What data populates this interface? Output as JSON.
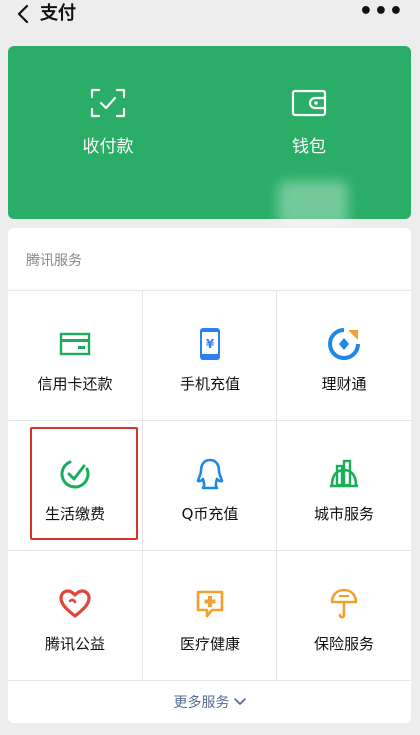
{
  "header": {
    "title": "支付",
    "more_label": "•••"
  },
  "pay_card": {
    "items": [
      {
        "label": "收付款",
        "icon": "scan-frame-icon"
      },
      {
        "label": "钱包",
        "icon": "wallet-icon"
      }
    ]
  },
  "services": {
    "heading": "腾讯服务",
    "items": [
      {
        "label": "信用卡还款",
        "icon": "credit-card-icon",
        "color": "#1aad5c"
      },
      {
        "label": "手机充值",
        "icon": "phone-yen-icon",
        "color": "#2e7ff0"
      },
      {
        "label": "理财通",
        "icon": "wealth-icon",
        "color": "#1e88e5"
      },
      {
        "label": "生活缴费",
        "icon": "check-circle-icon",
        "color": "#1aad5c"
      },
      {
        "label": "Q币充值",
        "icon": "penguin-icon",
        "color": "#1e88e5"
      },
      {
        "label": "城市服务",
        "icon": "city-icon",
        "color": "#1aad5c"
      },
      {
        "label": "腾讯公益",
        "icon": "heart-icon",
        "color": "#e0453d"
      },
      {
        "label": "医疗健康",
        "icon": "medical-icon",
        "color": "#f2a12c"
      },
      {
        "label": "保险服务",
        "icon": "umbrella-shield-icon",
        "color": "#f2a12c"
      }
    ],
    "more_label": "更多服务"
  },
  "colors": {
    "brand_green": "#2aae67",
    "highlight_red": "#d8302a",
    "link_blue": "#576b95"
  }
}
